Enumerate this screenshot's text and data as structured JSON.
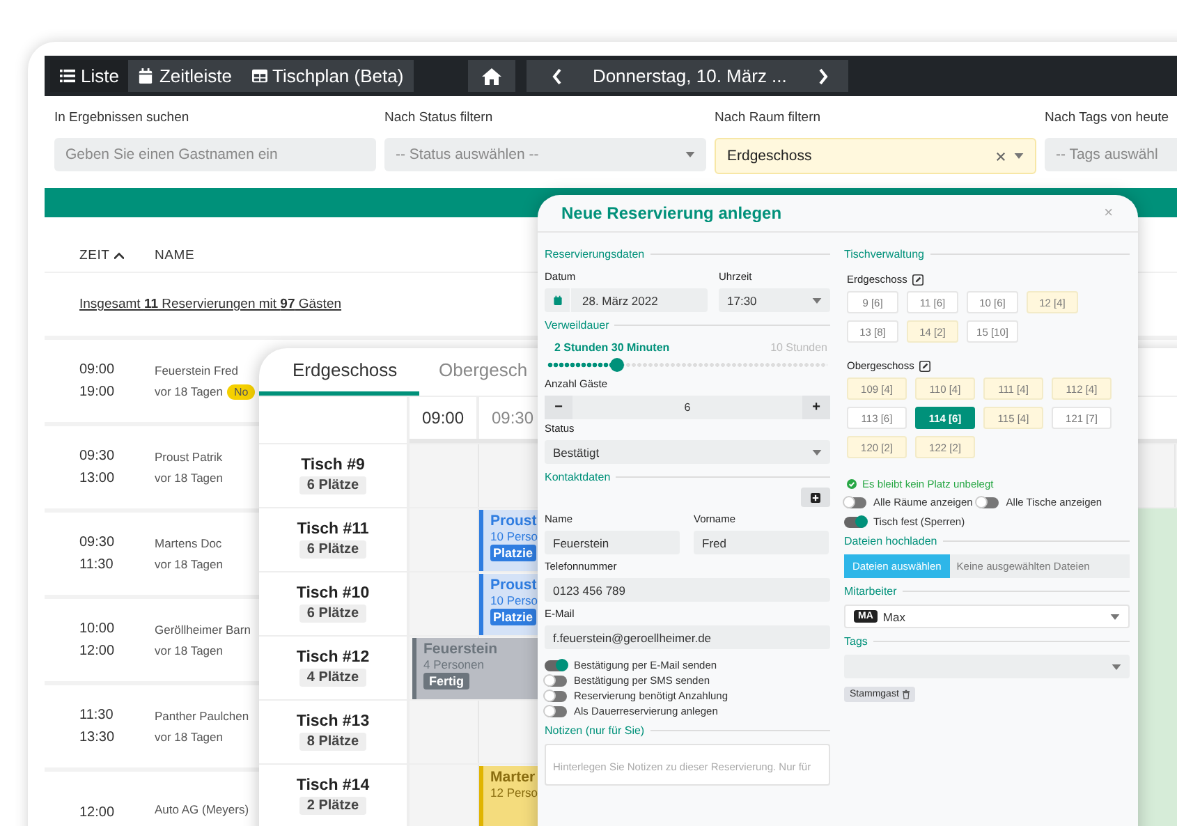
{
  "nav": {
    "views": [
      {
        "label": "Liste",
        "selected": true
      },
      {
        "label": "Zeitleiste",
        "selected": false
      },
      {
        "label": "Tischplan (Beta)",
        "selected": false
      }
    ],
    "date": "Donnerstag, 10. März ..."
  },
  "filters": [
    {
      "label": "In Ergebnissen suchen",
      "placeholder": "Geben Sie einen Gastnamen ein",
      "kind": "input"
    },
    {
      "label": "Nach Status filtern",
      "placeholder": "-- Status auswählen --",
      "kind": "select"
    },
    {
      "label": "Nach Raum filtern",
      "value": "Erdgeschoss",
      "kind": "select"
    },
    {
      "label": "Nach Tags von heute",
      "placeholder": "-- Tags auswähl",
      "kind": "select"
    }
  ],
  "list": {
    "columns": [
      {
        "label": "ZEIT",
        "sorted": true
      },
      {
        "label": "NAME",
        "sorted": false
      }
    ],
    "summary": "Insgesamt **11** Reservierungen mit **97** Gästen",
    "rows": [
      {
        "start": "09:00",
        "end": "19:00",
        "name": "Feuerstein Fred",
        "created": "vor 18 Tagen",
        "badge": "No"
      },
      {
        "start": "09:30",
        "end": "13:00",
        "name": "Proust Patrik",
        "created": "vor 18 Tagen"
      },
      {
        "start": "09:30",
        "end": "11:30",
        "name": "Martens Doc",
        "created": "vor 18 Tagen"
      },
      {
        "start": "10:00",
        "end": "12:00",
        "name": "Geröllheimer Barn",
        "created": "vor 18 Tagen"
      },
      {
        "start": "11:30",
        "end": "13:30",
        "name": "Panther Paulchen",
        "created": "vor 18 Tagen"
      },
      {
        "start": "12:00",
        "name": "Auto AG (Meyers)"
      }
    ]
  },
  "plan": {
    "tabs": [
      {
        "label": "Erdgeschoss",
        "selected": true
      },
      {
        "label": "Obergesch",
        "selected": false
      }
    ],
    "times": [
      "09:00",
      "09:30"
    ],
    "tables": [
      {
        "name": "Tisch #9",
        "seats": "6 Plätze"
      },
      {
        "name": "Tisch #11",
        "seats": "6 Plätze",
        "reservation": {
          "kind": "placed",
          "first_slot": false,
          "name": "Proust",
          "guests": "10 Perso",
          "status": "Platzie"
        }
      },
      {
        "name": "Tisch #10",
        "seats": "6 Plätze",
        "reservation": {
          "kind": "placed",
          "first_slot": false,
          "name": "Proust",
          "guests": "10 Perso",
          "status": "Platzie"
        }
      },
      {
        "name": "Tisch #12",
        "seats": "4 Plätze",
        "reservation": {
          "kind": "done",
          "first_slot": true,
          "name": "Feuerstein",
          "guests": "4 Personen",
          "status": "Fertig"
        }
      },
      {
        "name": "Tisch #13",
        "seats": "8 Plätze"
      },
      {
        "name": "Tisch #14",
        "seats": "2 Plätze",
        "reservation": {
          "kind": "pending",
          "first_slot": false,
          "name": "Marter",
          "guests": "12 Perso"
        }
      }
    ]
  },
  "modal": {
    "title": "Neue Reservierung anlegen",
    "close": "×",
    "reservation": {
      "heading": "Reservierungsdaten",
      "date_label": "Datum",
      "date": "28. März 2022",
      "time_label": "Uhrzeit",
      "time": "17:30"
    },
    "duration": {
      "heading": "Verweildauer",
      "value": "2 Stunden 30 Minuten",
      "max": "10 Stunden",
      "level": 0.25
    },
    "guests": {
      "label": "Anzahl Gäste",
      "minus": "−",
      "value": "6",
      "plus": "+"
    },
    "status": {
      "label": "Status",
      "value": "Bestätigt"
    },
    "contact": {
      "heading": "Kontaktdaten",
      "fields": [
        {
          "label": "Name",
          "value": "Feuerstein",
          "kind": "half"
        },
        {
          "label": "Vorname",
          "value": "Fred",
          "kind": "half"
        },
        {
          "label": "Telefonnummer",
          "value": "0123 456 789",
          "kind": "full"
        },
        {
          "label": "E-Mail",
          "value": "f.feuerstein@geroellheimer.de",
          "kind": "full"
        }
      ]
    },
    "options": [
      {
        "label": "Bestätigung per E-Mail senden",
        "on": true
      },
      {
        "label": "Bestätigung per SMS senden",
        "on": false
      },
      {
        "label": "Reservierung benötigt Anzahlung",
        "on": false
      },
      {
        "label": "Als Dauerreservierung anlegen",
        "on": false
      }
    ],
    "notes": {
      "heading": "Notizen (nur für Sie)",
      "placeholder": "Hinterlegen Sie Notizen zu dieser Reservierung. Nur für"
    },
    "table_management": {
      "heading": "Tischverwaltung",
      "rooms": [
        {
          "name": "Erdgeschoss",
          "tables": [
            {
              "label": "9 [6]",
              "occupied": false,
              "selected": false
            },
            {
              "label": "11 [6]",
              "occupied": false,
              "selected": false
            },
            {
              "label": "10 [6]",
              "occupied": false,
              "selected": false
            },
            {
              "label": "12 [4]",
              "occupied": true,
              "selected": false
            },
            {
              "label": "13 [8]",
              "occupied": false,
              "selected": false
            },
            {
              "label": "14 [2]",
              "occupied": true,
              "selected": false
            },
            {
              "label": "15 [10]",
              "occupied": false,
              "selected": false
            }
          ]
        },
        {
          "name": "Obergeschoss",
          "tables": [
            {
              "label": "109 [4]",
              "occupied": true,
              "selected": false
            },
            {
              "label": "110 [4]",
              "occupied": true,
              "selected": false
            },
            {
              "label": "111 [4]",
              "occupied": true,
              "selected": false
            },
            {
              "label": "112 [4]",
              "occupied": true,
              "selected": false
            },
            {
              "label": "113 [6]",
              "occupied": false,
              "selected": false
            },
            {
              "label": "114 [6]",
              "occupied": false,
              "selected": true
            },
            {
              "label": "115 [4]",
              "occupied": true,
              "selected": false
            },
            {
              "label": "121 [7]",
              "occupied": false,
              "selected": false
            },
            {
              "label": "120 [2]",
              "occupied": true,
              "selected": false
            },
            {
              "label": "122 [2]",
              "occupied": true,
              "selected": false
            }
          ]
        }
      ],
      "notice": "Es bleibt kein Platz unbelegt",
      "options": [
        {
          "label": "Alle Räume anzeigen",
          "on": false
        },
        {
          "label": "Alle Tische anzeigen",
          "on": false
        },
        {
          "label": "Tisch fest (Sperren)",
          "on": true
        }
      ]
    },
    "upload": {
      "heading": "Dateien hochladen",
      "button": "Dateien auswählen",
      "status": "Keine ausgewählten Dateien"
    },
    "staff": {
      "heading": "Mitarbeiter",
      "initials": "MA",
      "value": "Max"
    },
    "tags": {
      "heading": "Tags",
      "chips": [
        {
          "label": "Stammgast"
        }
      ]
    }
  }
}
